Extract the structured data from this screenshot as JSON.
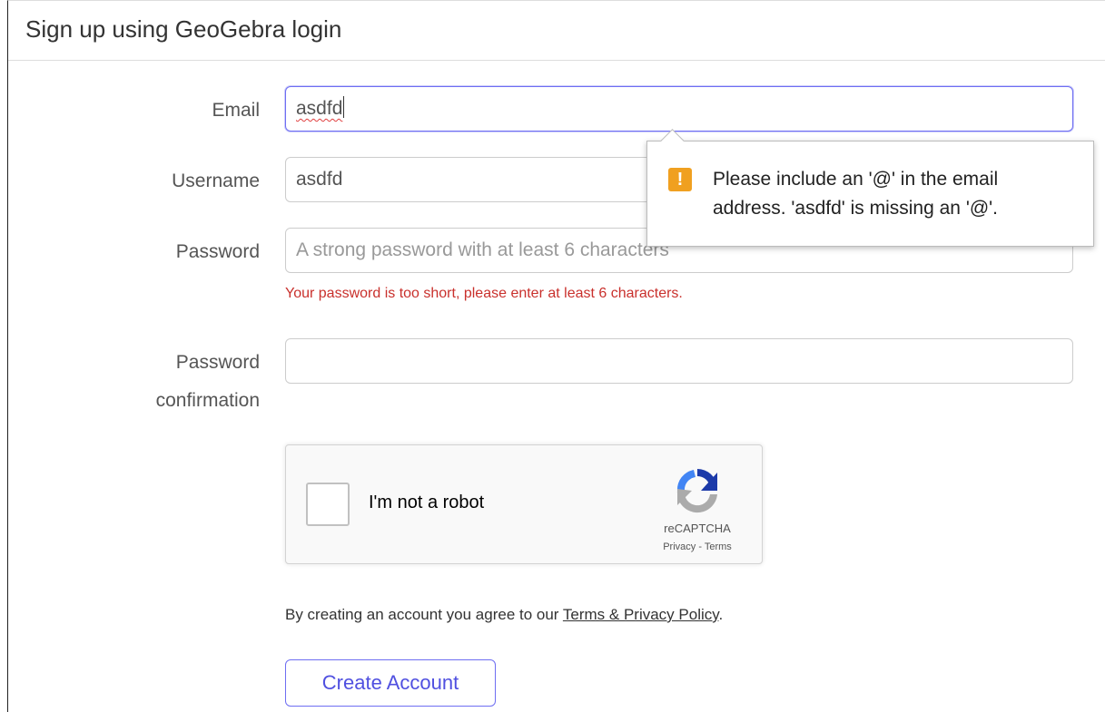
{
  "panel": {
    "title": "Sign up using GeoGebra login"
  },
  "form": {
    "email": {
      "label": "Email",
      "value": "asdfd"
    },
    "username": {
      "label": "Username",
      "value": "asdfd"
    },
    "password": {
      "label": "Password",
      "placeholder": "A strong password with at least 6 characters",
      "error": "Your password is too short, please enter at least 6 characters."
    },
    "password_confirmation": {
      "label_line1": "Password",
      "label_line2": "confirmation",
      "value": ""
    }
  },
  "validation_tooltip": {
    "icon": "warning-icon",
    "icon_glyph": "!",
    "message": "Please include an '@' in the email address. 'asdfd' is missing an '@'.",
    "icon_color": "#f0a020"
  },
  "captcha": {
    "label": "I'm not a robot",
    "brand": "reCAPTCHA",
    "links": "Privacy - Terms",
    "icon": "recaptcha-logo-icon"
  },
  "agreement": {
    "prefix": "By creating an account you agree to our ",
    "link": "Terms & Privacy Policy",
    "suffix": "."
  },
  "actions": {
    "create_account": "Create Account"
  },
  "colors": {
    "accent": "#6e6ef2",
    "error": "#c9302c"
  }
}
